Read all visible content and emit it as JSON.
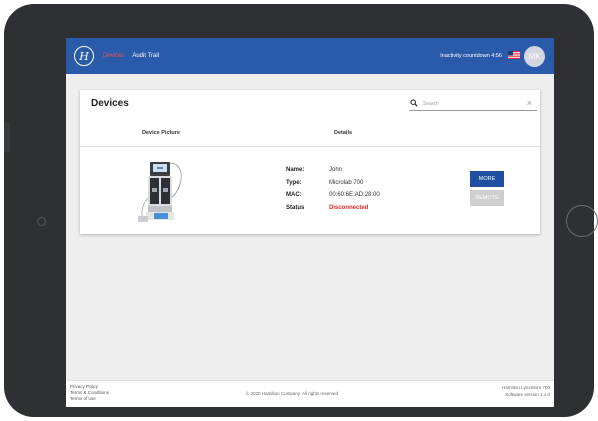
{
  "colors": {
    "topbar": "#2a5aaa",
    "active_nav": "#ff4f55",
    "status_disconnected": "#e02a2a",
    "primary_button": "#1f4fa0",
    "disabled_button": "#cfcfcf"
  },
  "header": {
    "logo_glyph": "H",
    "nav": {
      "devices": "Devices",
      "audit_trail": "Audit Trail"
    },
    "countdown": "Inactivity countdown 4:56",
    "flag_icon": "us-flag-icon",
    "avatar_initials": "MK"
  },
  "devices_card": {
    "title": "Devices",
    "search": {
      "placeholder": "Search",
      "value": "",
      "clear_glyph": "×"
    },
    "columns": {
      "picture": "Device Picture",
      "details": "Details"
    },
    "device": {
      "rows": [
        {
          "label": "Name:",
          "value": "John"
        },
        {
          "label": "Type:",
          "value": "Microlab 700"
        },
        {
          "label": "MAC:",
          "value": "00:60:6E:AD:28:00"
        },
        {
          "label": "Status",
          "value": "Disconnected"
        }
      ],
      "more_label": "MORE",
      "remote_label": "REMOTE"
    }
  },
  "footer": {
    "links": [
      "Privacy Policy",
      "Terms & Conditions",
      "Terms of use"
    ],
    "copyright": "© 2020 Hamilton Company. All rights reserved",
    "product_name": "Hamilton LynxStore 700",
    "version": "Software version 1.1.0"
  }
}
